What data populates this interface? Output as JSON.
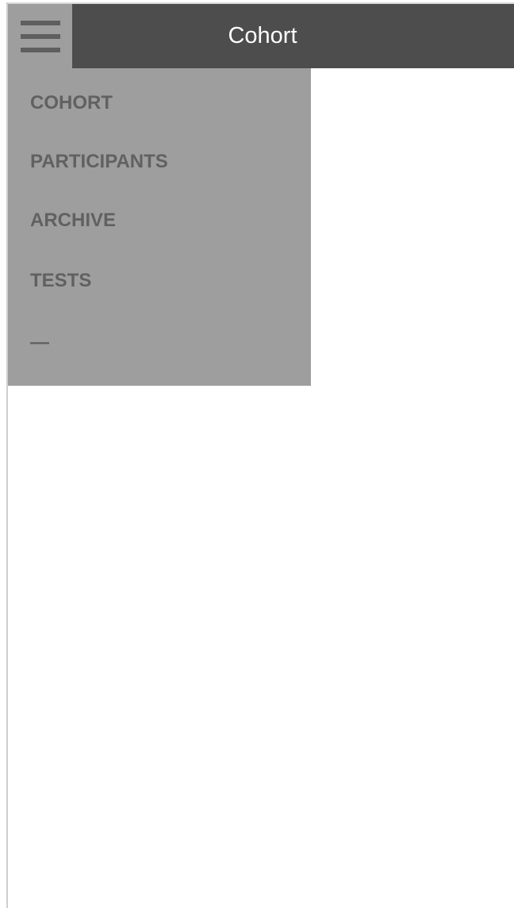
{
  "header": {
    "title": "Cohort",
    "menu_icon": "hamburger-menu-icon"
  },
  "drawer": {
    "items": [
      {
        "label": "COHORT"
      },
      {
        "label": "PARTICIPANTS"
      },
      {
        "label": "ARCHIVE"
      },
      {
        "label": "TESTS"
      },
      {
        "label": "—"
      }
    ]
  },
  "colors": {
    "header_bg": "#4d4d4d",
    "menu_button_bg": "#9e9e9e",
    "drawer_bg": "#9e9e9e",
    "drawer_text": "#616161",
    "title_text": "#ffffff"
  }
}
